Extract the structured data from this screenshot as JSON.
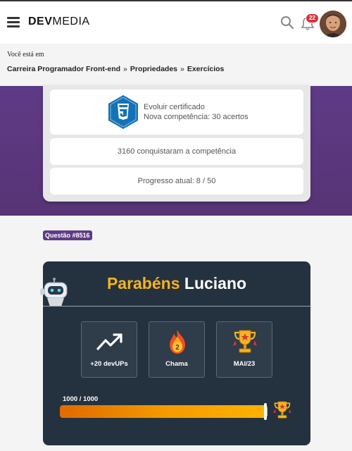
{
  "header": {
    "logo_bold": "DEV",
    "logo_light": "MEDIA",
    "notification_count": "22"
  },
  "breadcrumb": {
    "lead": "Você está em",
    "items": [
      "Carreira Programador Front-end",
      "Propriedades",
      "Exercícios"
    ],
    "separator": "»"
  },
  "competency": {
    "line1": "Evoluir certificado",
    "line2": "Nova competência: 30 acertos",
    "conquered": "3160 conquistaram a competência",
    "progress": "Progresso atual: 8 / 50"
  },
  "question_tag": "Questão #8516",
  "congrats": {
    "word1": "Parabéns",
    "word2": "Luciano",
    "tiles": [
      {
        "icon": "trend-up-icon",
        "label": "+20 devUPs"
      },
      {
        "icon": "flame-icon",
        "label": "Chama",
        "value": "2"
      },
      {
        "icon": "trophy-icon",
        "label": "MAI/23"
      }
    ],
    "progress_label": "1000 / 1000",
    "progress_fraction": 1.0
  },
  "colors": {
    "purple": "#5e3b86",
    "gold": "#f7b21d",
    "panel": "#24313f"
  }
}
